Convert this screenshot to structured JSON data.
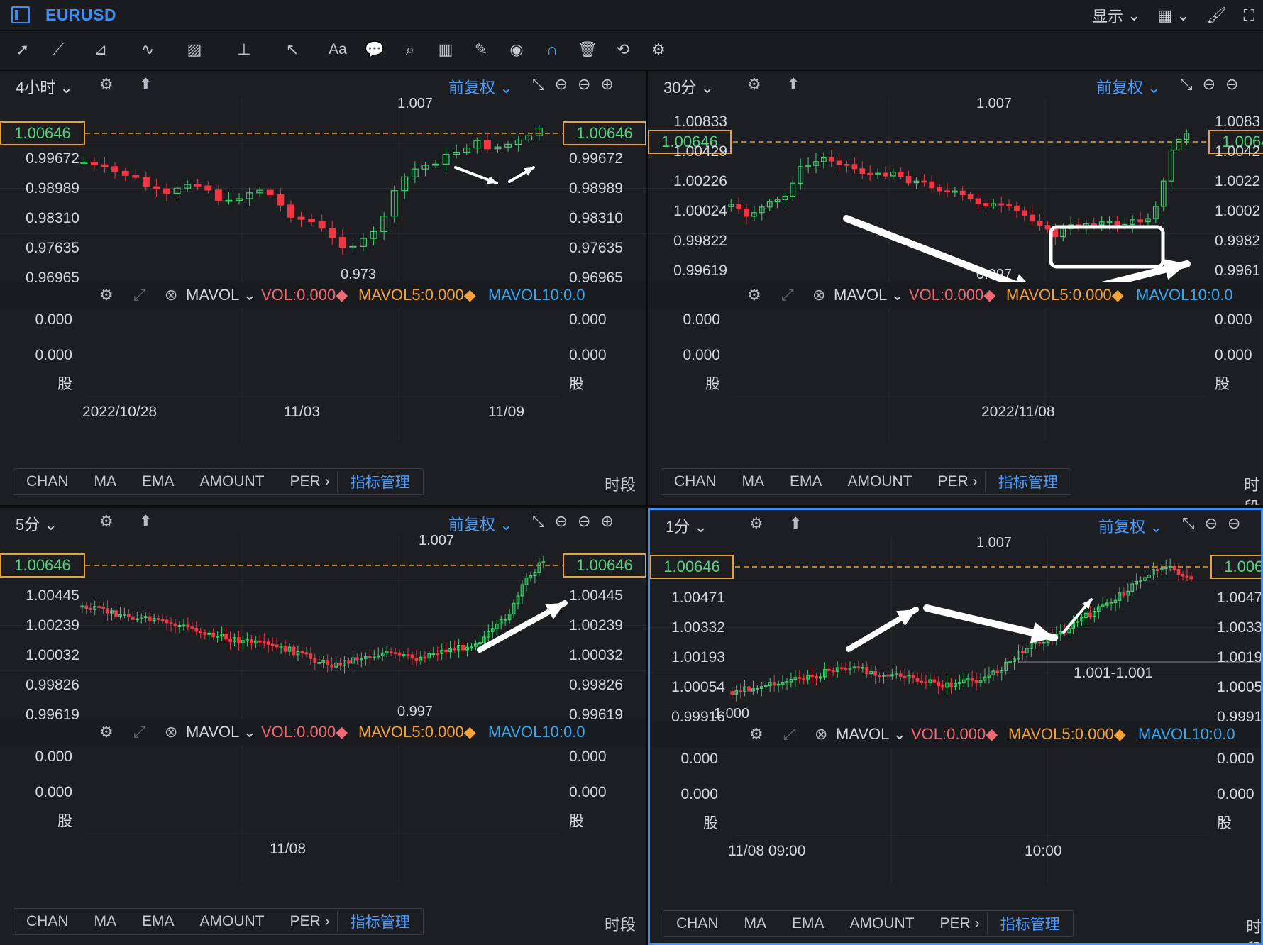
{
  "header": {
    "symbol": "EURUSD",
    "display_label": "显示"
  },
  "toolbar": {
    "text_tool": "Aa"
  },
  "common": {
    "adjust": "前复权",
    "vol_name": "MAVOL",
    "vol": "VOL:0.000",
    "mavol5": "MAVOL5:0.000",
    "mavol10": "MAVOL10:0.0",
    "vol_val": "0.000",
    "vol_unit": "股",
    "indicators": [
      "CHAN",
      "MA",
      "EMA",
      "AMOUNT",
      "PER"
    ],
    "indicator_mgr": "指标管理",
    "time_segment": "时段",
    "last_price": "1.00646",
    "colors": {
      "up": "#3ecf6e",
      "down": "#f23645",
      "accent": "#3d8ef7",
      "price_line": "#e9a13a"
    }
  },
  "panels": [
    {
      "timeframe": "4小时",
      "left_axis": [
        "0.99672",
        "0.98989",
        "0.98310",
        "0.97635",
        "0.96965"
      ],
      "right_axis": [
        "0.99672",
        "0.98989",
        "0.98310",
        "0.97635",
        "0.96965"
      ],
      "high_label": "1.007",
      "low_label": "0.973",
      "dates": [
        "2022/10/28",
        "11/03",
        "11/09"
      ]
    },
    {
      "timeframe": "30分",
      "left_axis": [
        "1.00833",
        "1.00429",
        "1.00226",
        "1.00024",
        "0.99822",
        "0.99619"
      ],
      "right_axis": [
        "1.0083",
        "1.0042",
        "1.0022",
        "1.0002",
        "0.9982",
        "0.9961"
      ],
      "high_label": "1.007",
      "low_label": "0.997",
      "dates": [
        "2022/11/08"
      ]
    },
    {
      "timeframe": "5分",
      "left_axis": [
        "1.00445",
        "1.00239",
        "1.00032",
        "0.99826",
        "0.99619"
      ],
      "right_axis": [
        "1.00445",
        "1.00239",
        "1.00032",
        "0.99826",
        "0.99619"
      ],
      "high_label": "1.007",
      "low_label": "0.997",
      "dates": [
        "11/08"
      ]
    },
    {
      "timeframe": "1分",
      "left_axis": [
        "1.00471",
        "1.00332",
        "1.00193",
        "1.00054",
        "0.99916"
      ],
      "right_axis": [
        "1.0047",
        "1.0033",
        "1.0019",
        "1.0005",
        "0.9991"
      ],
      "high_label": "1.007",
      "low_label": "1.000",
      "range_label": "1.001-1.001",
      "dates": [
        "11/08 09:00",
        "10:00"
      ]
    }
  ]
}
